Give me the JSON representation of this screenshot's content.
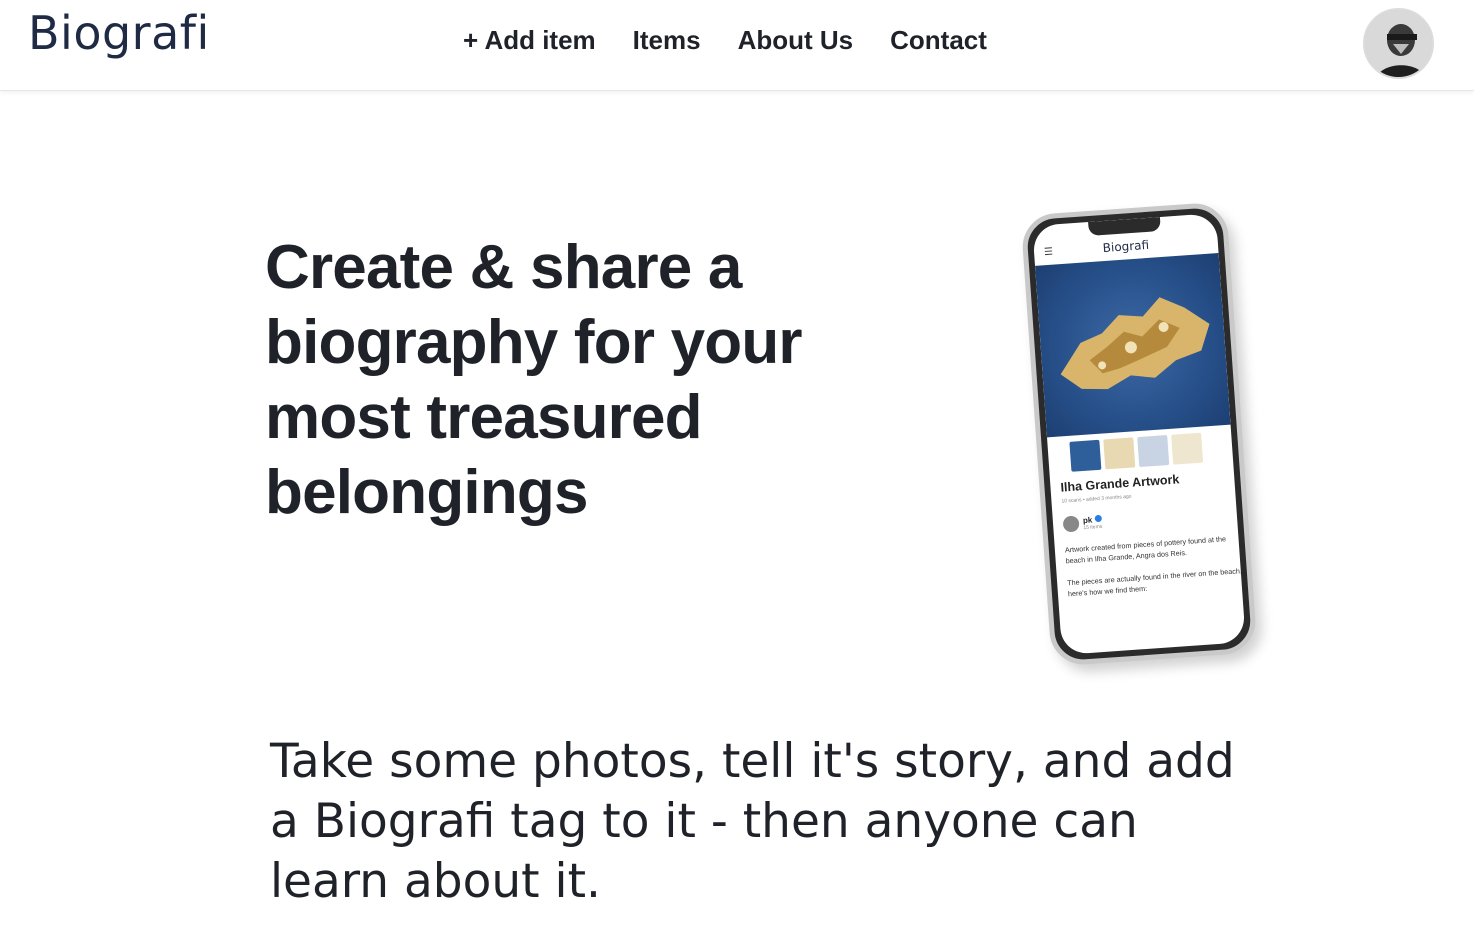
{
  "header": {
    "logo": "Biografi",
    "nav": [
      {
        "label": "+ Add item"
      },
      {
        "label": "Items"
      },
      {
        "label": "About Us"
      },
      {
        "label": "Contact"
      }
    ]
  },
  "hero": {
    "headline": "Create & share a biography for your most treasured belongings",
    "subline": "Take some photos, tell it's story, and add a Biografi tag to it - then anyone can learn about it."
  },
  "phone": {
    "app_title": "Biografi",
    "item_title": "Ilha Grande Artwork",
    "meta": "10 scans • added 3 months ago",
    "owner_name": "pk",
    "owner_count": "15 items",
    "description": [
      "Artwork created from pieces of pottery found at the beach in Ilha Grande, Angra dos Reis.",
      "The pieces are actually found in the river on the beach, here's how we find them:"
    ]
  },
  "colors": {
    "text": "#1f2329",
    "logo": "#1f2a44",
    "accent_blue": "#2a7de1"
  },
  "icons": {
    "avatar": "user-avatar-photo",
    "menu": "hamburger-menu-icon",
    "verified": "verified-check-icon"
  }
}
